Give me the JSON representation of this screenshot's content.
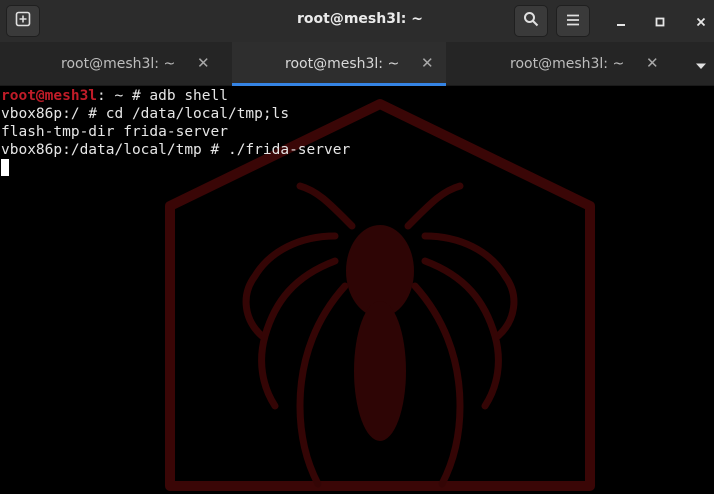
{
  "window": {
    "title": "root@mesh3l: ~",
    "controls": {
      "minimize": "minimize-icon",
      "maximize": "maximize-icon",
      "close": "close-icon"
    },
    "header_buttons": [
      "new-tab-icon",
      "search-icon",
      "hamburger-menu-icon"
    ]
  },
  "tabs": [
    {
      "label": "root@mesh3l: ~",
      "active": false
    },
    {
      "label": "root@mesh3l: ~",
      "active": true
    },
    {
      "label": "root@mesh3l: ~",
      "active": false
    }
  ],
  "terminal": {
    "prompt_user": "root@mesh3l",
    "prompt_rest": ": ~ # adb shell",
    "lines": [
      "vbox86p:/ # cd /data/local/tmp;ls",
      "flash-tmp-dir frida-server",
      "vbox86p:/data/local/tmp # ./frida-server"
    ]
  },
  "colors": {
    "accent": "#3584e4",
    "prompt_user": "#c01c28",
    "background": "#000000",
    "wallpaper": "#3a0606"
  }
}
